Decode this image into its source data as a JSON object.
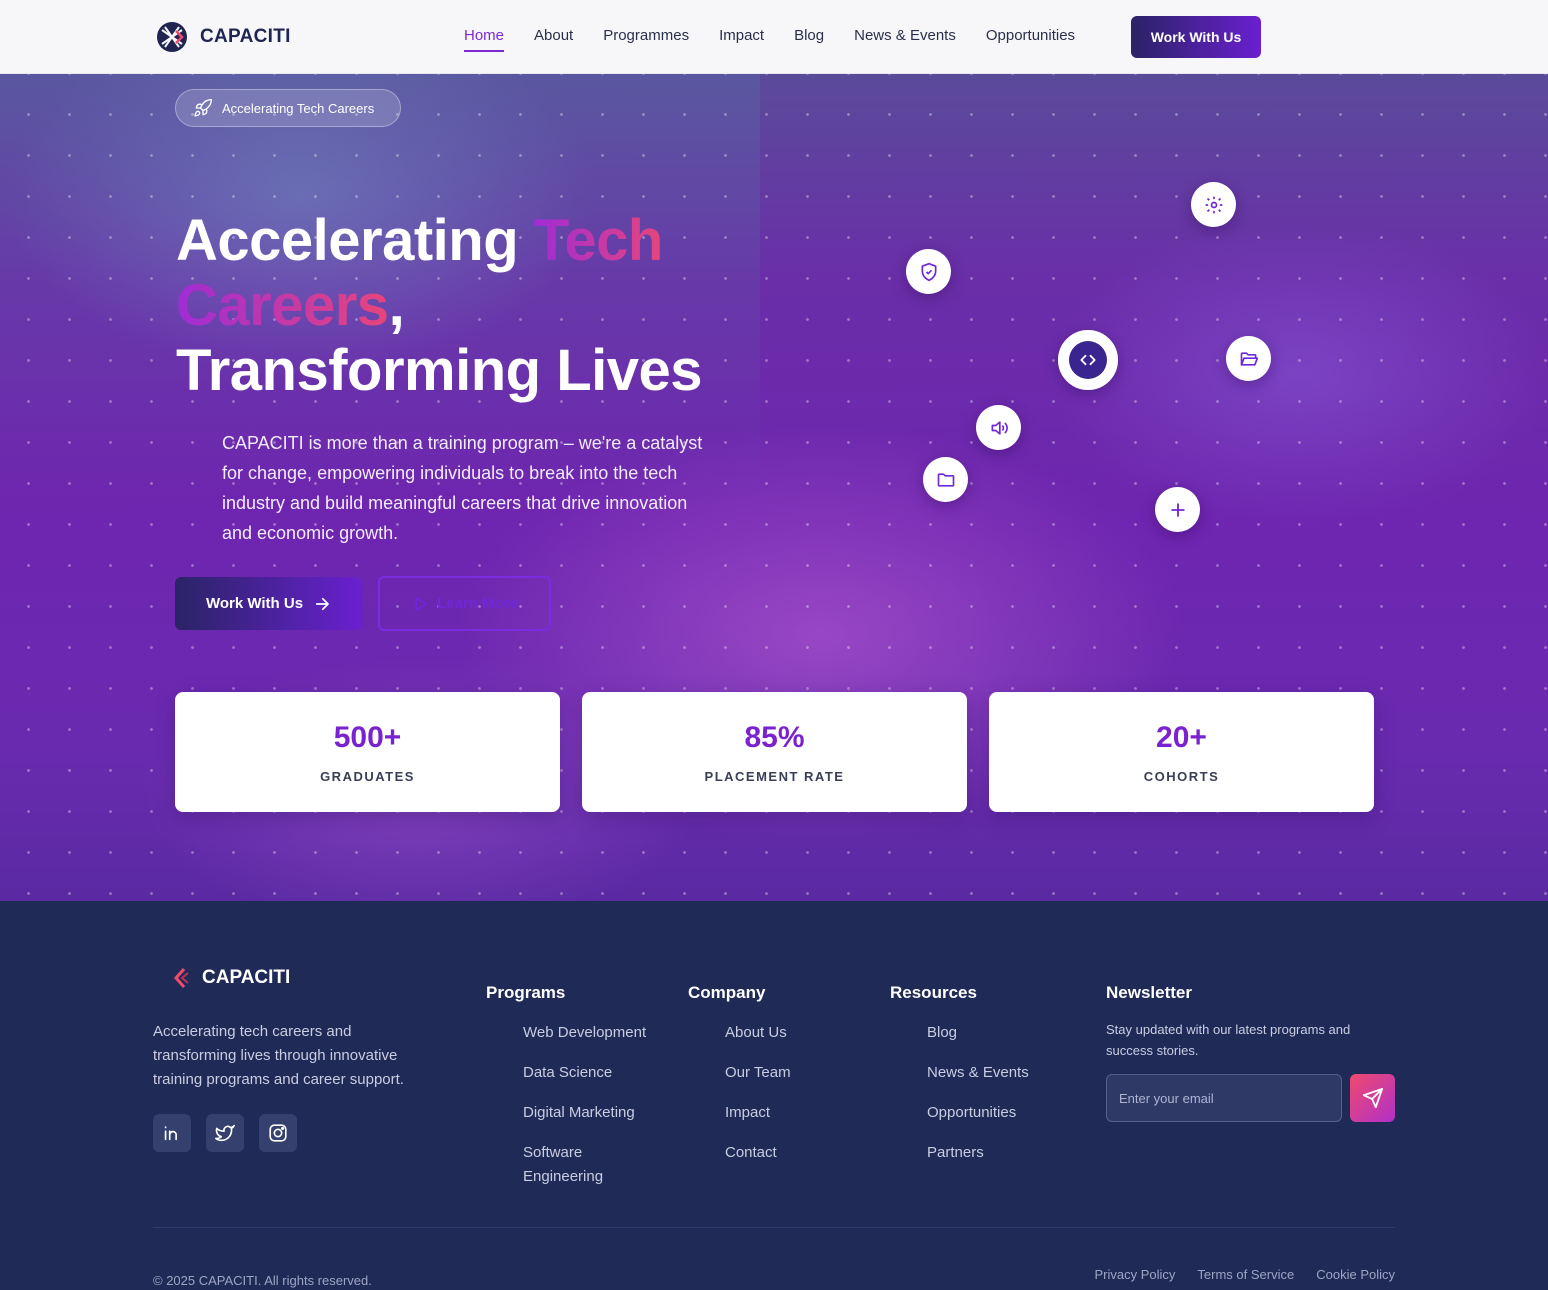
{
  "nav": {
    "brand": "CAPACITI",
    "links": [
      "Home",
      "About",
      "Programmes",
      "Impact",
      "Blog",
      "News & Events",
      "Opportunities"
    ],
    "active": "Home",
    "cta": "Work With Us"
  },
  "hero": {
    "badge": "Accelerating Tech Careers",
    "headline": {
      "part1": "Accelerating ",
      "highlight1": "Tech",
      "highlight2": "Careers",
      "part2": ",",
      "line3": "Transforming Lives"
    },
    "description": "CAPACITI is more than a training program – we're a catalyst for change, empowering individuals to break into the tech industry and build meaningful careers that drive innovation and economic growth.",
    "primary_button": "Work With Us",
    "secondary_button": "Learn More",
    "floating_icons": [
      "gear-icon",
      "shield-icon",
      "code-icon",
      "folder-open-icon",
      "speaker-icon",
      "folder-icon",
      "plus-icon"
    ],
    "stats": [
      {
        "value": "500+",
        "label": "GRADUATES"
      },
      {
        "value": "85%",
        "label": "PLACEMENT RATE"
      },
      {
        "value": "20+",
        "label": "COHORTS"
      }
    ]
  },
  "footer": {
    "brand": "CAPACITI",
    "about": "Accelerating tech careers and transforming lives through innovative training programs and career support.",
    "social": [
      "linkedin-icon",
      "twitter-icon",
      "instagram-icon"
    ],
    "programs": {
      "title": "Programs",
      "items": [
        "Web Development",
        "Data Science",
        "Digital Marketing",
        "Software Engineering"
      ]
    },
    "company": {
      "title": "Company",
      "items": [
        "About Us",
        "Our Team",
        "Impact",
        "Contact"
      ]
    },
    "resources": {
      "title": "Resources",
      "items": [
        "Blog",
        "News & Events",
        "Opportunities",
        "Partners"
      ]
    },
    "newsletter": {
      "title": "Newsletter",
      "text": "Stay updated with our latest programs and success stories.",
      "placeholder": "Enter your email"
    },
    "copyright": "© 2025 CAPACITI. All rights reserved.",
    "legal": [
      "Privacy Policy",
      "Terms of Service",
      "Cookie Policy"
    ]
  },
  "colors": {
    "accent": "#7b2ad1",
    "navy": "#1f2a57",
    "pink": "#e8457a"
  }
}
